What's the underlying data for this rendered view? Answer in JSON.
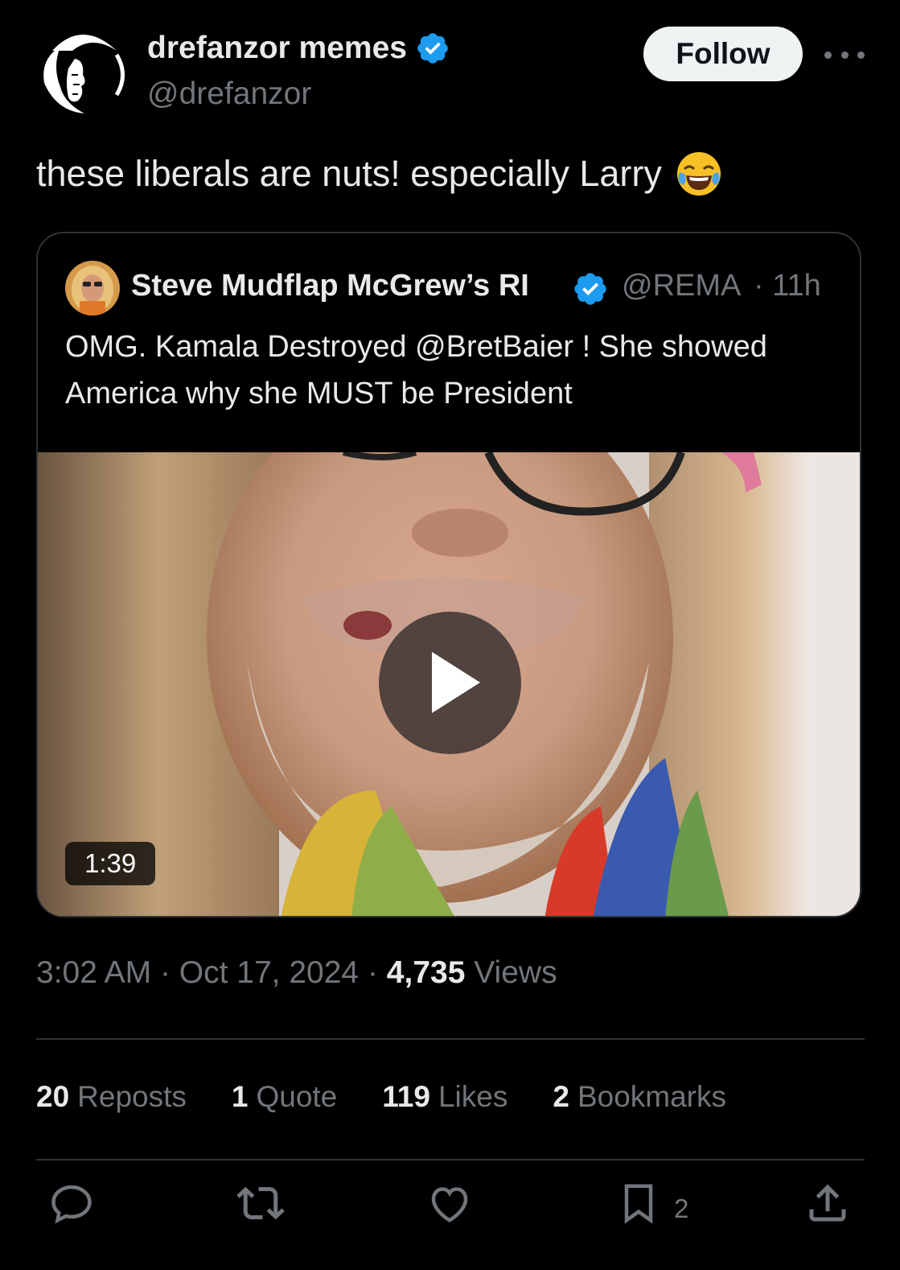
{
  "author": {
    "display_name": "drefanzor memes",
    "handle": "@drefanzor",
    "verified": true
  },
  "follow_label": "Follow",
  "tweet_text": "these liberals are nuts! especially Larry",
  "tweet_emoji": "😂",
  "quoted": {
    "display_name": "Steve Mudflap McGrew’s RI",
    "handle": "@REMA",
    "time": "· 11h",
    "verified": true,
    "text": "OMG. Kamala Destroyed @BretBaier ! She showed America why she MUST be President",
    "video_duration": "1:39"
  },
  "meta": {
    "time": "3:02 AM",
    "date": "Oct 17, 2024",
    "views_count": "4,735",
    "views_label": "Views",
    "separator": "·"
  },
  "stats": {
    "reposts_count": "20",
    "reposts_label": "Reposts",
    "quotes_count": "1",
    "quotes_label": "Quote",
    "likes_count": "119",
    "likes_label": "Likes",
    "bookmarks_count": "2",
    "bookmarks_label": "Bookmarks"
  },
  "actions": {
    "bookmark_count": "2"
  },
  "colors": {
    "background": "#000000",
    "text": "#e7e9ea",
    "muted": "#71767b",
    "verified": "#1d9bf0",
    "border": "#2f3336"
  }
}
